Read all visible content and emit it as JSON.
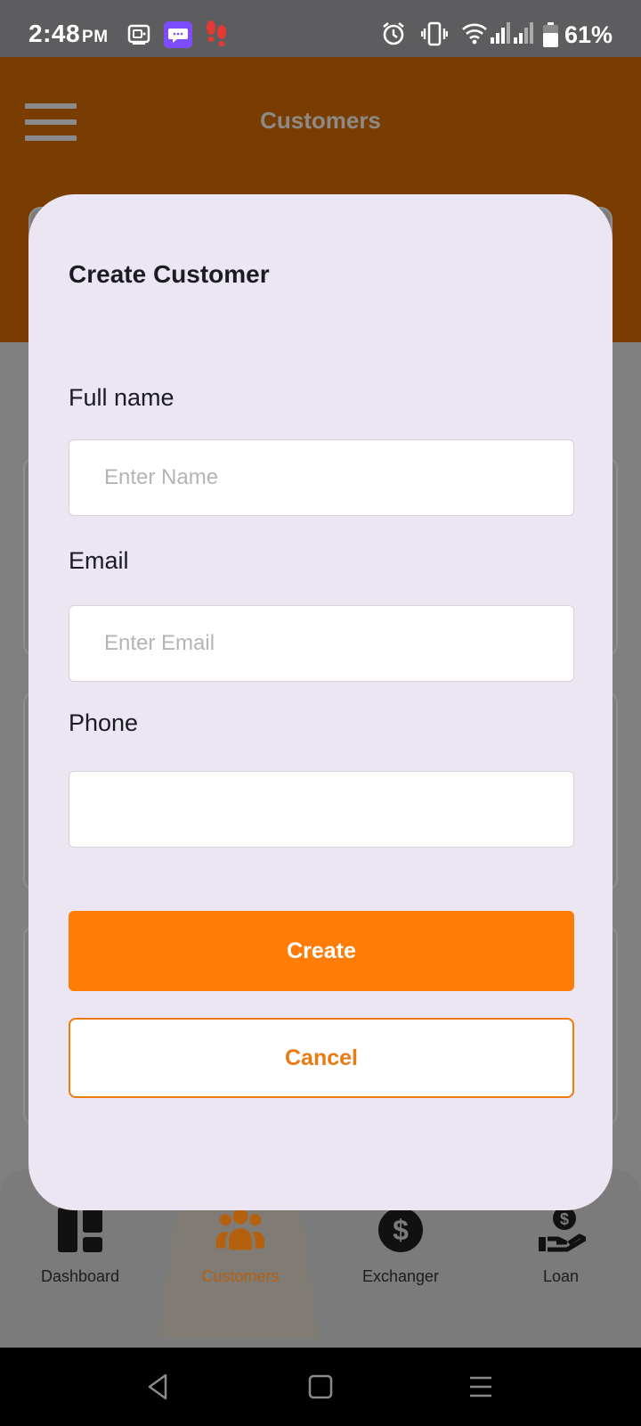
{
  "status_bar": {
    "time": "2:48",
    "ampm": "PM",
    "battery_percent": "61%",
    "icons": [
      "screen-recorder-icon",
      "chat-app-icon",
      "footsteps-icon",
      "alarm-icon",
      "vibrate-icon",
      "wifi-icon",
      "signal-icon",
      "signal-icon",
      "battery-icon"
    ]
  },
  "app_bar": {
    "title": "Customers",
    "menu_icon": "hamburger-menu-icon"
  },
  "modal": {
    "title": "Create Customer",
    "fields": {
      "full_name": {
        "label": "Full name",
        "placeholder": "Enter Name",
        "value": ""
      },
      "email": {
        "label": "Email",
        "placeholder": "Enter Email",
        "value": ""
      },
      "phone": {
        "label": "Phone",
        "placeholder": "",
        "value": ""
      }
    },
    "create_label": "Create",
    "cancel_label": "Cancel"
  },
  "bottom_nav": {
    "items": [
      {
        "label": "Dashboard",
        "icon": "dashboard-icon",
        "active": false
      },
      {
        "label": "Customers",
        "icon": "customers-icon",
        "active": true
      },
      {
        "label": "Exchanger",
        "icon": "dollar-coin-icon",
        "active": false
      },
      {
        "label": "Loan",
        "icon": "loan-hand-icon",
        "active": false
      }
    ]
  },
  "system_nav": {
    "buttons": [
      "back-icon",
      "home-icon",
      "recents-icon"
    ]
  },
  "colors": {
    "status_bar": "#5d5d60",
    "app_bar": "#7a3d01",
    "overlay": "#808080",
    "modal_bg": "#ece6f2",
    "accent": "#ff7d06",
    "active_nav": "#b4600f"
  }
}
